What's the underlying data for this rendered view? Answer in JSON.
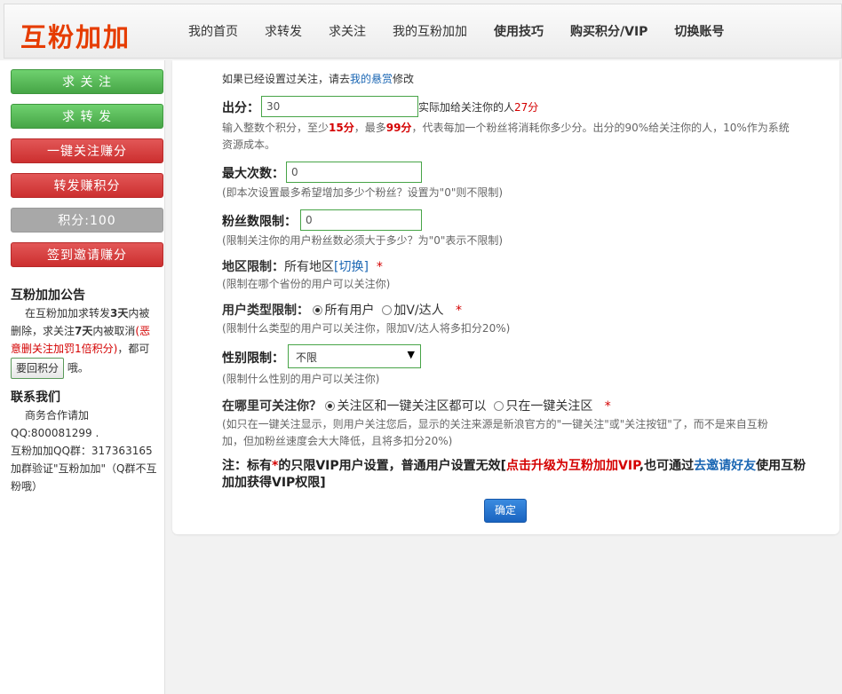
{
  "header": {
    "logo": "互粉加加",
    "nav": [
      {
        "label": "我的首页",
        "bold": false
      },
      {
        "label": "求转发",
        "bold": false
      },
      {
        "label": "求关注",
        "bold": false
      },
      {
        "label": "我的互粉加加",
        "bold": false
      },
      {
        "label": "使用技巧",
        "bold": true
      },
      {
        "label": "购买积分/VIP",
        "bold": true
      },
      {
        "label": "切换账号",
        "bold": true
      }
    ]
  },
  "sidebar": {
    "buttons": {
      "qiu_guanzhu": "求 关 注",
      "qiu_zhuanfa": "求 转 发",
      "yijian_guanzhu": "一键关注赚分",
      "zhuanfa_zhuan": "转发赚积分",
      "score": "积分:100",
      "qiandao": "签到邀请赚分"
    },
    "notice": {
      "title": "互粉加加公告",
      "line1": "在互粉加加求转发",
      "line1b": "3天",
      "line1c": "内被删除，求关注",
      "line1d": "7天",
      "line1e": "内被取消",
      "penalty": "(恶意删关注加罚1倍积分)",
      "tail1": "，都可",
      "back_button": "要回积分",
      "tail2": "哦。"
    },
    "contact": {
      "title": "联系我们",
      "line1": "商务合作请加",
      "qq": "QQ:800081299 .",
      "group": "互粉加加QQ群：317363165",
      "verify": "加群验证\"互粉加加\"（Q群不互粉哦）"
    }
  },
  "main": {
    "top_note_prefix": "如果已经设置过关注，请去",
    "top_note_link": "我的悬赏",
    "top_note_suffix": "修改",
    "chufen": {
      "label": "出分：",
      "value": "30",
      "after_prefix": "实际加给关注你的人",
      "after_value": "27分",
      "hint_prefix": "输入整数个积分，至少",
      "hint_min": "15分",
      "hint_mid": "，最多",
      "hint_max": "99分",
      "hint_suffix": "，代表每加一个粉丝将消耗你多少分。出分的90%给关注你的人，10%作为系统",
      "hint_line2": "资源成本。"
    },
    "max_count": {
      "label": "最大次数：",
      "value": "0",
      "hint": "(即本次设置最多希望增加多少个粉丝？设置为\"0\"则不限制)"
    },
    "fans_limit": {
      "label": "粉丝数限制：",
      "value": "0",
      "hint": "(限制关注你的用户粉丝数必须大于多少？为\"0\"表示不限制)"
    },
    "region": {
      "label": "地区限制：",
      "value": "所有地区",
      "switch_link": "[切换]",
      "star": "*",
      "hint": "(限制在哪个省份的用户可以关注你)"
    },
    "user_type": {
      "label": "用户类型限制：",
      "options": [
        "所有用户",
        "加V/达人"
      ],
      "selected": "所有用户",
      "star": "*",
      "hint": "(限制什么类型的用户可以关注你，限加V/达人将多扣分20%)"
    },
    "gender": {
      "label": "性别限制：",
      "value": "不限",
      "hint": "(限制什么性别的用户可以关注你)"
    },
    "where": {
      "label": "在哪里可关注你？",
      "options": [
        "关注区和一键关注区都可以",
        "只在一键关注区"
      ],
      "selected": "关注区和一键关注区都可以",
      "star": "*",
      "hint_line1": "(如只在一键关注显示，则用户关注您后，显示的关注来源是新浪官方的\"一键关注\"或\"关注按钮\"了，而不是来自互粉",
      "hint_line2": "加，但加粉丝速度会大大降低，且将多扣分20%)"
    },
    "vip_note": {
      "prefix": "注：标有",
      "star": "*",
      "mid": "的只限VIP用户设置，普通用户设置无效[",
      "upgrade": "点击升级为互粉加加VIP",
      "mid2": ",也可通过",
      "invite": "去邀请好友",
      "suffix": "使用互粉",
      "line2": "加加获得VIP权限]"
    },
    "ok_button": "确定"
  }
}
